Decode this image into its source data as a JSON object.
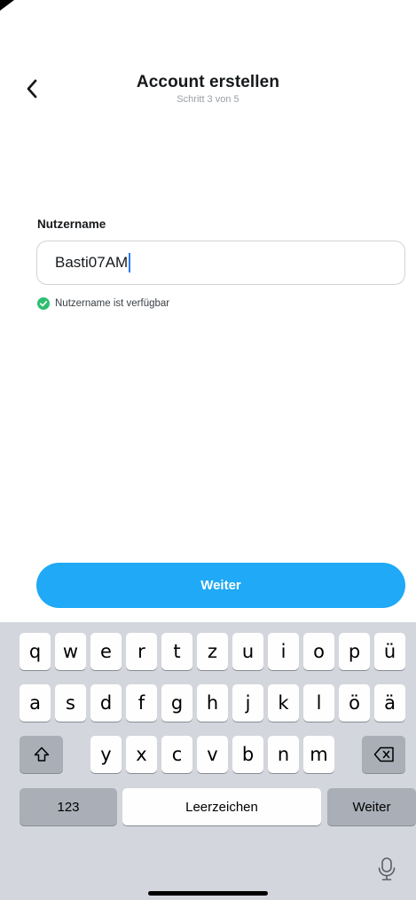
{
  "header": {
    "title": "Account erstellen",
    "subtitle": "Schritt 3 von 5"
  },
  "form": {
    "label": "Nutzername",
    "value": "Basti07AM",
    "status": "Nutzername ist verfügbar"
  },
  "primary_button": "Weiter",
  "keyboard": {
    "row1": [
      "q",
      "w",
      "e",
      "r",
      "t",
      "z",
      "u",
      "i",
      "o",
      "p",
      "ü"
    ],
    "row2": [
      "a",
      "s",
      "d",
      "f",
      "g",
      "h",
      "j",
      "k",
      "l",
      "ö",
      "ä"
    ],
    "row3": [
      "y",
      "x",
      "c",
      "v",
      "b",
      "n",
      "m"
    ],
    "numbers_key": "123",
    "space_key": "Leerzeichen",
    "return_key": "Weiter"
  },
  "colors": {
    "accent": "#1fa9f6",
    "success": "#2fbf71",
    "keyboard_bg": "#d3d6dc"
  },
  "icons": [
    "chevron-left-icon",
    "checkmark-circle-icon",
    "shift-icon",
    "backspace-icon",
    "microphone-icon"
  ]
}
